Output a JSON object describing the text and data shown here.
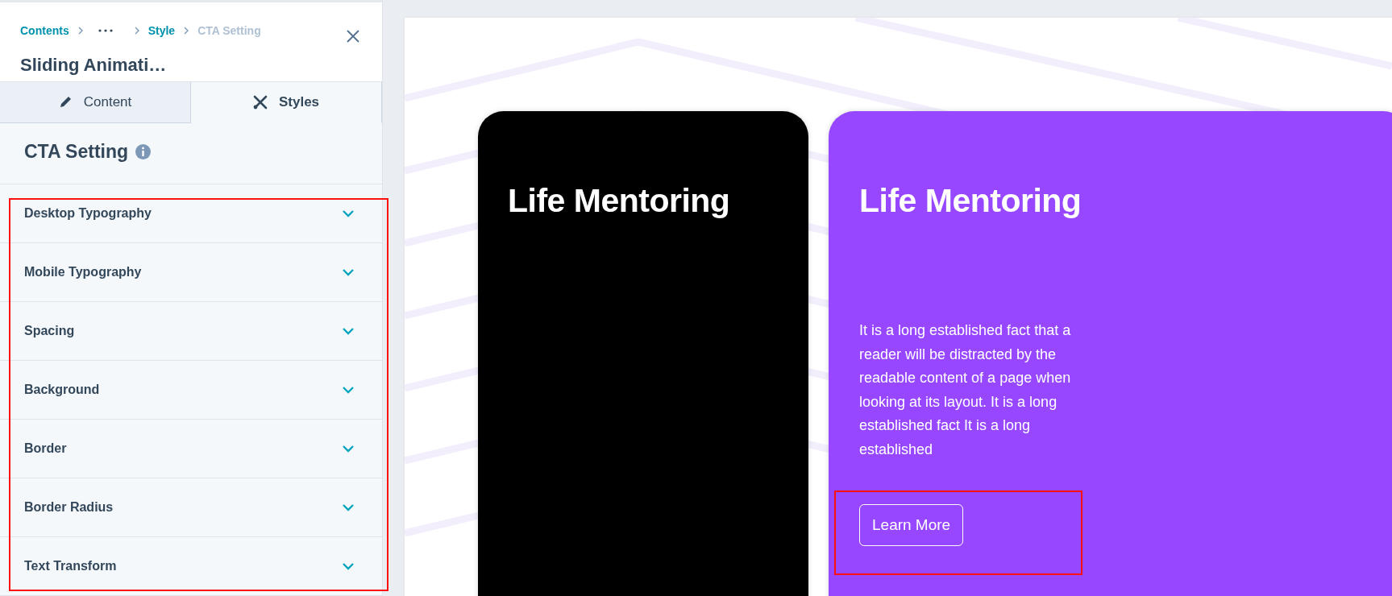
{
  "breadcrumb": [
    {
      "kind": "link",
      "label": "Contents"
    },
    {
      "kind": "more"
    },
    {
      "kind": "link",
      "label": "Style"
    },
    {
      "kind": "current",
      "label": "CTA Setting"
    }
  ],
  "panel_title": "Sliding Animati…",
  "tabs": [
    {
      "kind": "pencil",
      "label": "Content",
      "selected": false
    },
    {
      "kind": "tools",
      "label": "Styles",
      "selected": true
    }
  ],
  "section_title": "CTA Setting",
  "accordion": [
    {
      "label": "Desktop Typography",
      "expanded": false
    },
    {
      "label": "Mobile Typography",
      "expanded": false
    },
    {
      "label": "Spacing",
      "expanded": false
    },
    {
      "label": "Background",
      "expanded": false
    },
    {
      "label": "Border",
      "expanded": false
    },
    {
      "label": "Border Radius",
      "expanded": false
    },
    {
      "label": "Text Transform",
      "expanded": false
    }
  ],
  "cards": [
    {
      "title": "Life Mentoring",
      "color": "#000000"
    },
    {
      "title": "Life Mentoring",
      "color": "#9747ff",
      "text": "It is a long established fact that a reader will be distracted by the readable content of a page when looking at its layout. It is a long established fact It is a long established",
      "button": "Learn More"
    }
  ]
}
